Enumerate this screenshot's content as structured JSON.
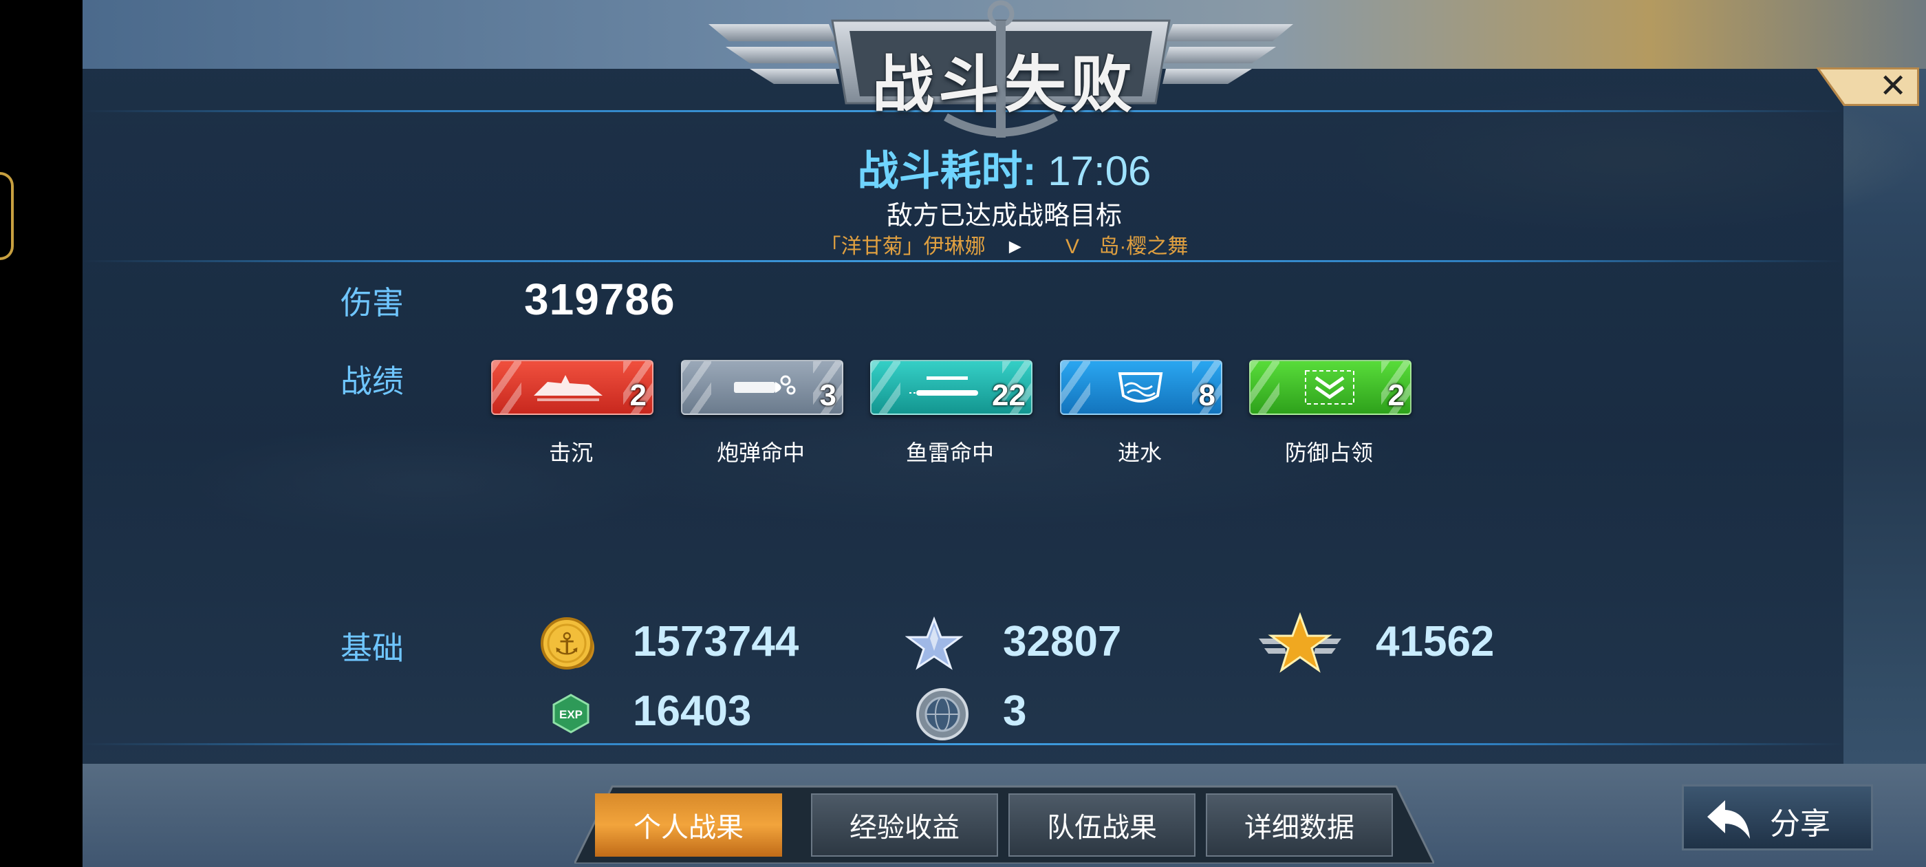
{
  "header": {
    "title": "战斗失败",
    "time_label": "战斗耗时:",
    "time_value": "17:06",
    "subtitle": "敌方已达成战略目标",
    "ship_name": "「洋甘菊」伊琳娜",
    "tier": "V",
    "map_name": "岛·樱之舞"
  },
  "damage": {
    "label": "伤害",
    "value": "319786"
  },
  "record": {
    "label": "战绩",
    "items": [
      {
        "label": "击沉",
        "count": "2",
        "color": "#e0352a",
        "icon": "sinking-ship-icon"
      },
      {
        "label": "炮弹命中",
        "count": "3",
        "color": "#8796a8",
        "icon": "shell-icon"
      },
      {
        "label": "鱼雷命中",
        "count": "22",
        "color": "#23b3ad",
        "icon": "torpedo-icon"
      },
      {
        "label": "进水",
        "count": "8",
        "color": "#1b8fd6",
        "icon": "flooding-icon"
      },
      {
        "label": "防御占领",
        "count": "2",
        "color": "#3fbf2a",
        "icon": "defense-chevron-icon"
      }
    ]
  },
  "basic": {
    "label": "基础",
    "gold": {
      "icon": "gold-coin-icon",
      "value": "1573744"
    },
    "silver_star": {
      "icon": "silver-star-icon",
      "value": "32807"
    },
    "gold_star": {
      "icon": "winged-gold-star-icon",
      "value": "41562"
    },
    "exp": {
      "icon": "exp-badge-icon",
      "value": "16403",
      "badge_text": "EXP"
    },
    "globe": {
      "icon": "globe-medal-icon",
      "value": "3"
    }
  },
  "tabs": [
    {
      "label": "个人战果",
      "active": true
    },
    {
      "label": "经验收益",
      "active": false
    },
    {
      "label": "队伍战果",
      "active": false
    },
    {
      "label": "详细数据",
      "active": false
    }
  ],
  "share": {
    "label": "分享"
  },
  "colors": {
    "accent_blue": "#6fc6ff",
    "active_tab": "#f2a43c",
    "ship_text": "#e0a040"
  }
}
